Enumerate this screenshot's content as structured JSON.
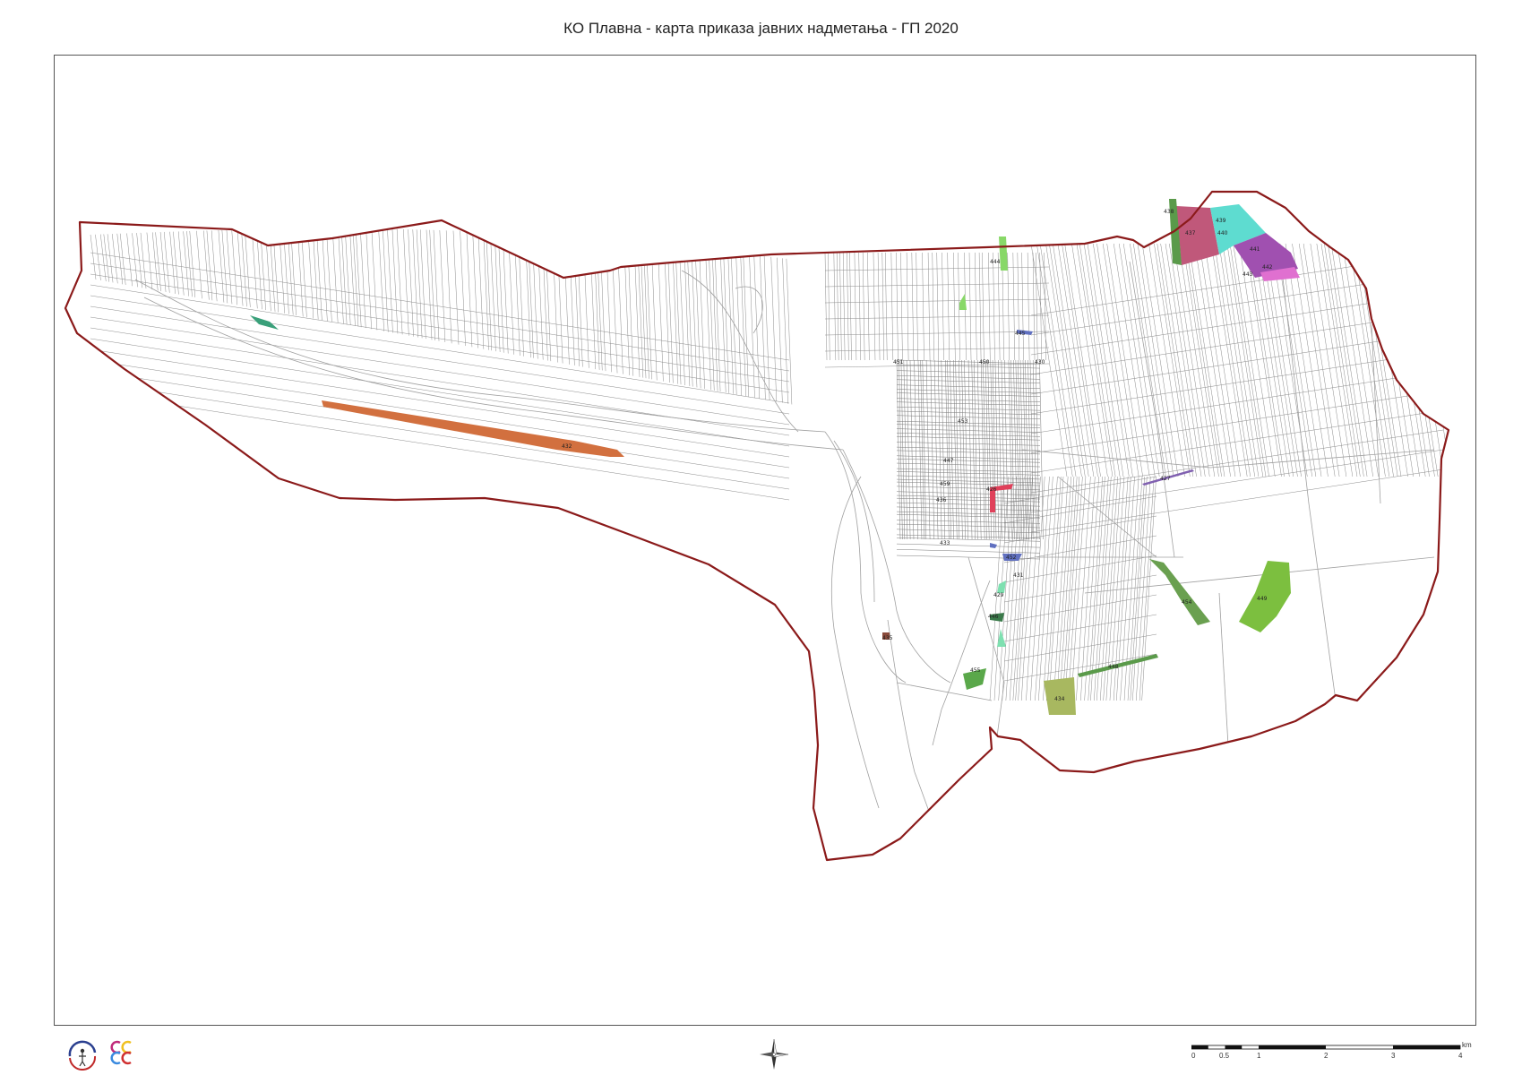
{
  "title": "КО Плавна - карта приказа јавних надметања -  ГП 2020",
  "colors": {
    "boundary": "#8b1a1a",
    "parcel_lines": "#9a9a9a",
    "orange": "#d2703f",
    "magenta": "#c0587a",
    "cyan": "#5edcd0",
    "purple": "#a050b0",
    "pink": "#e070d0",
    "green_light": "#88d868",
    "green_mid": "#7cbf3f",
    "green_dark": "#5a9a4a",
    "teal": "#3aa07a",
    "olive": "#a8b860",
    "mint": "#7ee0b0",
    "blue": "#6070c0",
    "red": "#e0405a"
  },
  "parcels": [
    {
      "id": "a",
      "label": "432"
    },
    {
      "id": "b",
      "label": "437"
    },
    {
      "id": "c",
      "label": "439"
    },
    {
      "id": "d",
      "label": "440"
    },
    {
      "id": "e",
      "label": "441"
    },
    {
      "id": "f",
      "label": "442"
    },
    {
      "id": "g",
      "label": "438"
    },
    {
      "id": "h",
      "label": "443"
    },
    {
      "id": "i",
      "label": "444"
    },
    {
      "id": "j",
      "label": "445"
    },
    {
      "id": "k",
      "label": "451"
    },
    {
      "id": "l",
      "label": "450"
    },
    {
      "id": "m",
      "label": "430"
    },
    {
      "id": "n",
      "label": "453"
    },
    {
      "id": "o",
      "label": "447"
    },
    {
      "id": "p",
      "label": "459"
    },
    {
      "id": "q",
      "label": "436"
    },
    {
      "id": "r",
      "label": "426"
    },
    {
      "id": "s",
      "label": "433"
    },
    {
      "id": "t",
      "label": "452"
    },
    {
      "id": "u",
      "label": "431"
    },
    {
      "id": "v",
      "label": "429"
    },
    {
      "id": "w",
      "label": "446"
    },
    {
      "id": "x",
      "label": "455"
    },
    {
      "id": "y",
      "label": "434"
    },
    {
      "id": "z",
      "label": "448"
    },
    {
      "id": "aa",
      "label": "454"
    },
    {
      "id": "ab",
      "label": "449"
    },
    {
      "id": "ac",
      "label": "427"
    },
    {
      "id": "ad",
      "label": "435"
    }
  ],
  "scale": {
    "ticks": [
      "0",
      "0.5",
      "1",
      "2",
      "3",
      "4"
    ],
    "unit": "km"
  }
}
